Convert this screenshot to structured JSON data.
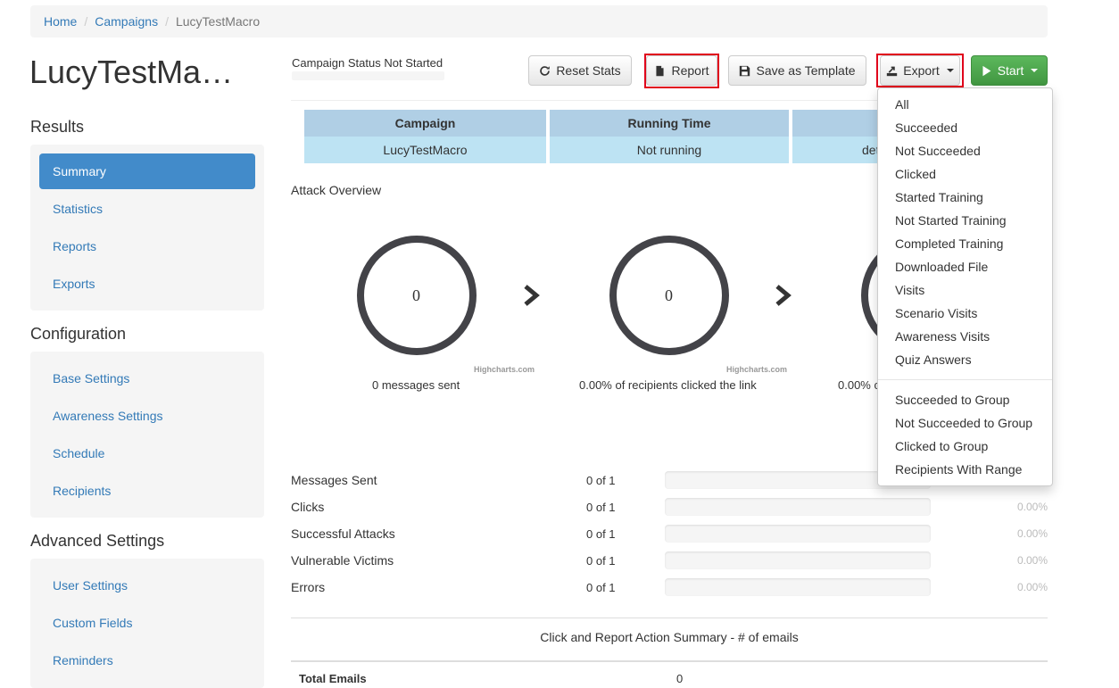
{
  "breadcrumb": {
    "home": "Home",
    "campaigns": "Campaigns",
    "current": "LucyTestMacro"
  },
  "page_title": "LucyTestMa…",
  "campaign_status": {
    "label": "Campaign Status",
    "value": "Not Started"
  },
  "toolbar": {
    "reset_label": "Reset Stats",
    "report_label": "Report",
    "template_label": "Save as Template",
    "export_label": "Export",
    "start_label": "Start"
  },
  "sidebar": {
    "results_heading": "Results",
    "results_items": [
      "Summary",
      "Statistics",
      "Reports",
      "Exports"
    ],
    "config_heading": "Configuration",
    "config_items": [
      "Base Settings",
      "Awareness Settings",
      "Schedule",
      "Recipients"
    ],
    "advanced_heading": "Advanced Settings",
    "advanced_items": [
      "User Settings",
      "Custom Fields",
      "Reminders"
    ]
  },
  "info_table": {
    "headers": [
      "Campaign",
      "Running Time"
    ],
    "values": [
      "LucyTestMacro",
      "Not running",
      "det"
    ]
  },
  "attack_overview": {
    "title": "Attack Overview",
    "donuts": [
      {
        "value": "0",
        "caption": "0 messages sent",
        "credit": "Highcharts.com"
      },
      {
        "value": "0",
        "caption": "0.00% of recipients clicked the link",
        "credit": "Highcharts.com"
      },
      {
        "caption": "0.00% c"
      }
    ]
  },
  "stats": [
    {
      "label": "Messages Sent",
      "count": "0 of 1",
      "pct": ""
    },
    {
      "label": "Clicks",
      "count": "0 of 1",
      "pct": "0.00%"
    },
    {
      "label": "Successful Attacks",
      "count": "0 of 1",
      "pct": "0.00%"
    },
    {
      "label": "Vulnerable Victims",
      "count": "0 of 1",
      "pct": "0.00%"
    },
    {
      "label": "Errors",
      "count": "0 of 1",
      "pct": "0.00%"
    }
  ],
  "summary": {
    "title": "Click and Report Action Summary - # of emails",
    "total_label": "Total Emails",
    "total_value": "0"
  },
  "export_menu": {
    "group1": [
      "All",
      "Succeeded",
      "Not Succeeded",
      "Clicked",
      "Started Training",
      "Not Started Training",
      "Completed Training",
      "Downloaded File",
      "Visits",
      "Scenario Visits",
      "Awareness Visits",
      "Quiz Answers"
    ],
    "group2": [
      "Succeeded to Group",
      "Not Succeeded to Group",
      "Clicked to Group",
      "Recipients With Range"
    ]
  },
  "colors": {
    "link": "#337ab7",
    "active": "#428bca",
    "start": "#5cb85c",
    "highlight": "#e0001b",
    "donut_ring": "#434348"
  }
}
